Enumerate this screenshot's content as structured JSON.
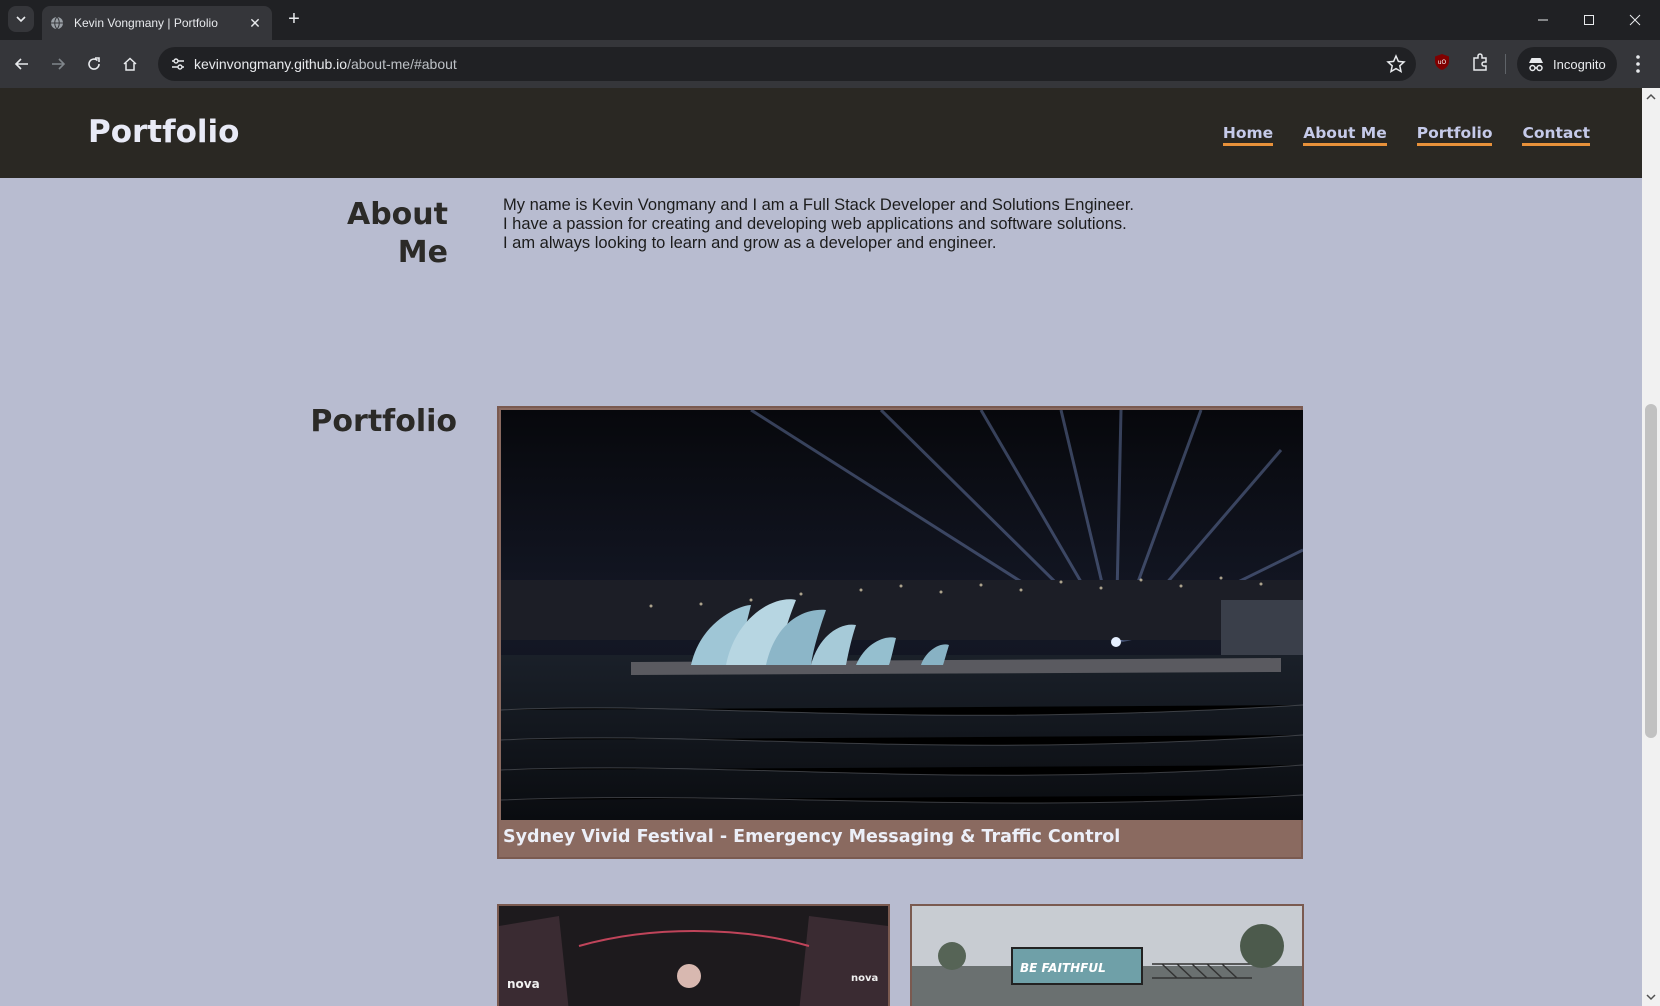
{
  "browser": {
    "tab_title": "Kevin Vongmany | Portfolio",
    "url_host": "kevinvongmany.github.io",
    "url_path": "/about-me/#about",
    "incognito_label": "Incognito",
    "icons": [
      "tab-list-icon",
      "globe-icon",
      "close-icon",
      "plus-icon",
      "minimize-icon",
      "maximize-icon",
      "window-close-icon",
      "back-icon",
      "forward-icon",
      "reload-icon",
      "home-icon",
      "site-settings-icon",
      "bookmark-star-icon",
      "ublock-icon",
      "extensions-icon",
      "incognito-icon",
      "menu-icon"
    ]
  },
  "header": {
    "brand": "Portfolio",
    "nav": [
      "Home",
      "About Me",
      "Portfolio",
      "Contact"
    ],
    "accent_color": "#e8913a"
  },
  "about": {
    "heading_line1": "About",
    "heading_line2": "Me",
    "lines": [
      "My name is Kevin Vongmany and I am a Full Stack Developer and Solutions Engineer.",
      "I have a passion for creating and developing web applications and software solutions.",
      "I am always looking to learn and grow as a developer and engineer."
    ]
  },
  "portfolio": {
    "heading": "Portfolio",
    "featured_caption": "Sydney Vivid Festival - Emergency Messaging & Traffic Control",
    "thumbnail_a_text": "nova",
    "thumbnail_b_text": "BE FAITHFUL"
  },
  "colors": {
    "page_bg": "#b8bcd0",
    "header_bg": "#2a2823",
    "card_bg": "#8a6a60"
  }
}
